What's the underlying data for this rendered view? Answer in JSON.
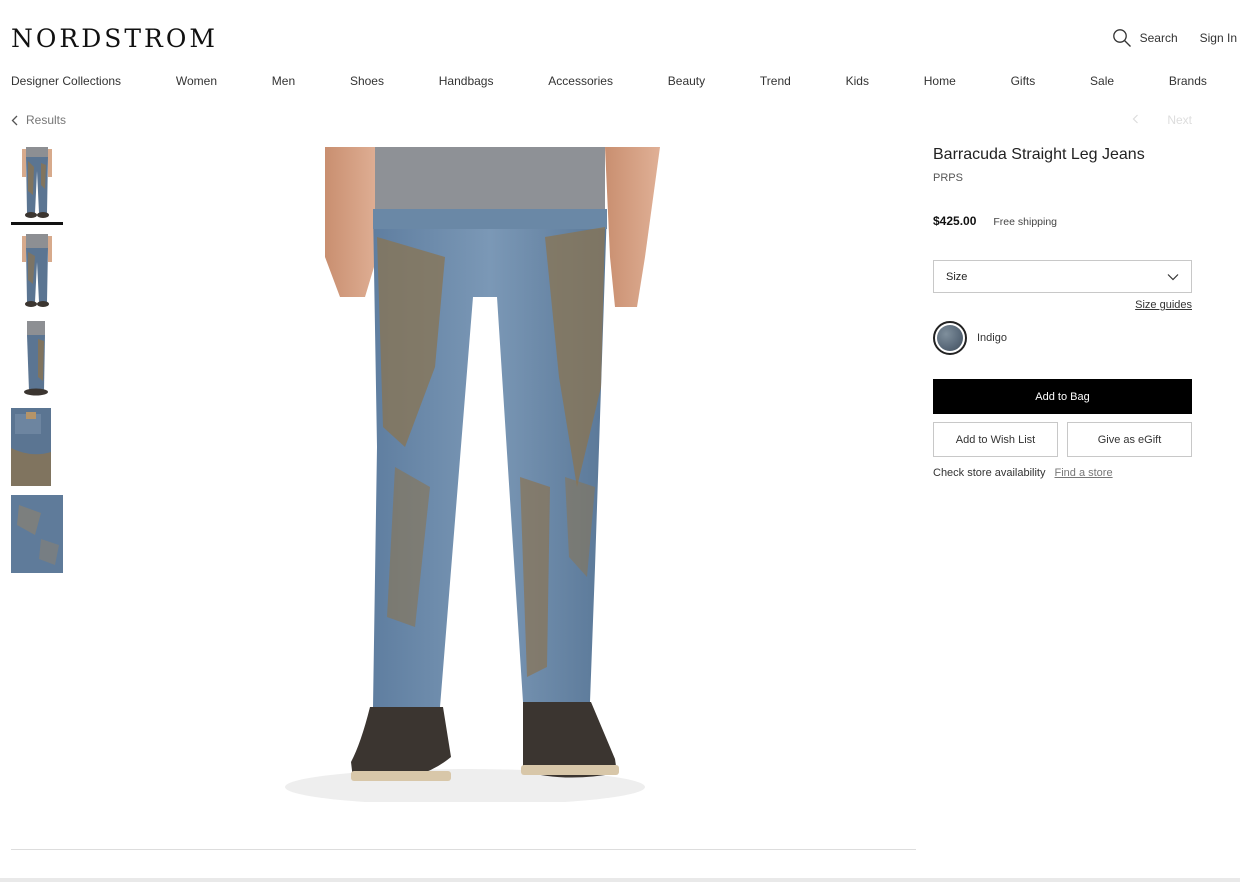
{
  "header": {
    "logo": "NORDSTROM",
    "search_label": "Search",
    "signin_label": "Sign In"
  },
  "nav": [
    "Designer Collections",
    "Women",
    "Men",
    "Shoes",
    "Handbags",
    "Accessories",
    "Beauty",
    "Trend",
    "Kids",
    "Home",
    "Gifts",
    "Sale",
    "Brands"
  ],
  "breadcrumb": {
    "back_label": "Results"
  },
  "pager": {
    "next_label": "Next"
  },
  "gallery": {
    "thumbnail_count": 5,
    "active_index": 0
  },
  "product": {
    "title": "Barracuda Straight Leg Jeans",
    "brand": "PRPS",
    "price": "$425.00",
    "shipping": "Free shipping",
    "size_placeholder": "Size",
    "size_guides_label": "Size guides",
    "color_name": "Indigo",
    "add_to_bag_label": "Add to Bag",
    "wish_list_label": "Add to Wish List",
    "egift_label": "Give as eGift",
    "store_availability_label": "Check store availability",
    "find_store_label": "Find a store"
  },
  "colors": {
    "primary_button": "#000000",
    "denim": "#5b7592",
    "mud": "#8a7452"
  }
}
